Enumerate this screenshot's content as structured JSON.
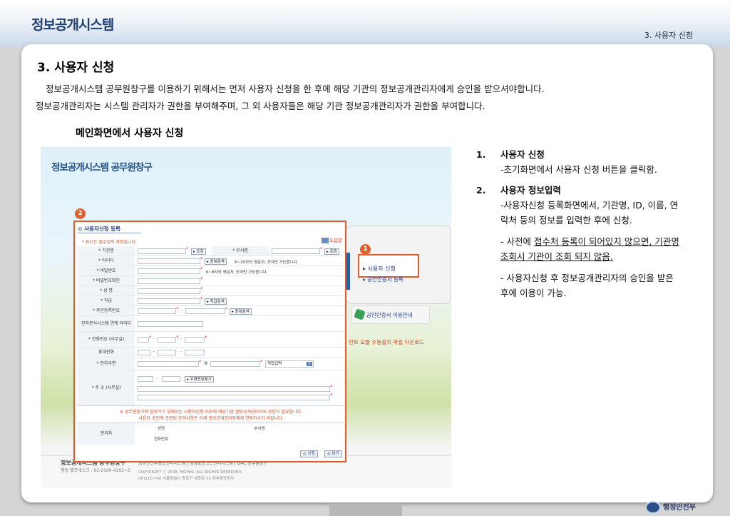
{
  "header": {
    "brand": "정보공개시스템",
    "breadcrumb": "3. 사용자 신청"
  },
  "section": {
    "title": "3. 사용자 신청",
    "para1": "정보공개시스템 공무원창구를 이용하기 위해서는 먼저 사용자 신청을 한 후에 해당 기관의 정보공개관리자에게 승인을 받으셔야합니다.",
    "para2": "정보공개관리자는 시스템 관리자가 권한을 부여해주며, 그 외 사용자들은 해당 기관 정보공개관리자가 권한을 부여합니다.",
    "subtitle": "메인화면에서 사용자 신청"
  },
  "screenshot": {
    "title": "정보공개시스템 공무원창구",
    "badge1": "1",
    "badge2": "2",
    "apply_link": "▸ 사용자 신청",
    "cert_link": "▸ 공인인증서 등록",
    "cert_guide": "공인인증서 이용안내",
    "download": "인트 모듈 수동설치 파일 다운로드",
    "footer_title": "정보공개시스템 공무원창구",
    "footer_tel": "행정 헬프데스크 : 02-2100-4162~5",
    "footer_links": "행정안전부홍보관리시스템   |   행정표준코드관리시스템   |   G4C 공무원창구",
    "footer_copy1": "COPYRIGHT ⓒ 2008, MOPAS.  ALL RIGHTS RESERVED.",
    "footer_copy2": "(우)110-760  서울특별시 종로구 세종로 55 정부중앙청사",
    "form": {
      "title": "◎ 사용자신청 등록",
      "required_note": "* 표시는 필수입력 사항입니다.",
      "help": "도움말",
      "labels": {
        "org": "* 기관명",
        "dept": "* 부서명",
        "id": "* 아이디",
        "pw": "* 비밀번호",
        "pw_confirm": "* 비밀번호확인",
        "name": "* 성 명",
        "position": "* 직급",
        "rrn": "* 주민등록번호",
        "edoc": "전자문서시스템 연계 아이디",
        "tel": "* 전화번호 (사무실)",
        "mobile": "휴대전화",
        "email": "* 전자우편",
        "addr": "* 주 소 (사무실)",
        "manager": "관리자",
        "mgr_name": "성명",
        "mgr_dept": "부서명",
        "mgr_tel": "전화번호"
      },
      "buttons": {
        "search": "▸ 조회",
        "dup_check": "▸ 중복검색",
        "position_search": "▸ 직급검색",
        "dup_check2": "▸ 중복검색",
        "zip_search": "▸ 우편번호찾기",
        "submit": "◎ 신청",
        "close": "◎ 닫기"
      },
      "hints": {
        "id_hint": "6~15자의 영문자, 숫자만 가능합니다.",
        "pw_hint": "6~8자의 영문자, 숫자만 가능합니다.",
        "email_at": "@",
        "email_select": "직접입력"
      },
      "notice1": "※ 공무원창구에 접속하기 위해서는 사용자신청 이후에 해당기관 정보공개관리자의 승인이 필요합니다.",
      "notice2": "사용자 승인에 관련된 문의사항은 아래 정보공개관리자에게 연락하시기 바랍니다."
    }
  },
  "notes": {
    "item1_num": "1.",
    "item1_head": "사용자 신청",
    "item1_body": "-초기화면에서 사용자 신청 버튼을 클릭함.",
    "item2_num": "2.",
    "item2_head": "사용자 정보입력",
    "item2_body": "-사용자신청 등록화면에서, 기관명, ID, 이름, 연락처 등의 정보를 입력한 후에 신청.",
    "dash1_prefix": "- 사전에 ",
    "dash1_underlined": "접수처 등록이 되어있지 않으면, 기관명 조회시 기관이 조회 되지 않음.",
    "dash2": "- 사용자신청 후 정보공개관리자의 승인을 받은 후에 이용이 가능."
  },
  "footer": {
    "ministry": "행정안전부"
  },
  "colors": {
    "accent": "#e8592a",
    "brand": "#1d3f77"
  }
}
